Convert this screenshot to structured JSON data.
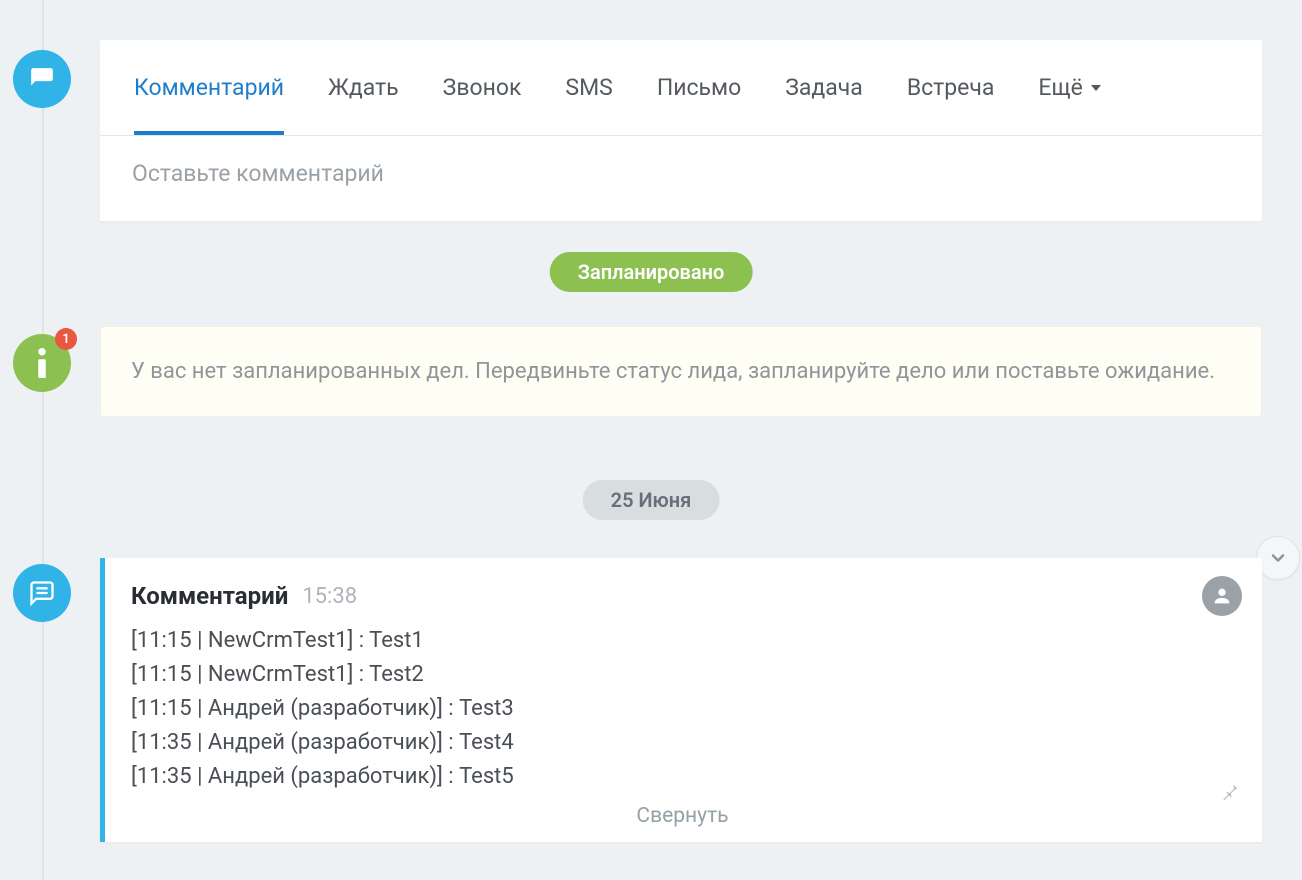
{
  "tabs": {
    "items": [
      {
        "label": "Комментарий",
        "name": "tab-comment",
        "active": true
      },
      {
        "label": "Ждать",
        "name": "tab-wait",
        "active": false
      },
      {
        "label": "Звонок",
        "name": "tab-call",
        "active": false
      },
      {
        "label": "SMS",
        "name": "tab-sms",
        "active": false
      },
      {
        "label": "Письмо",
        "name": "tab-email",
        "active": false
      },
      {
        "label": "Задача",
        "name": "tab-task",
        "active": false
      },
      {
        "label": "Встреча",
        "name": "tab-meeting",
        "active": false
      }
    ],
    "more_label": "Ещё"
  },
  "comment_input": {
    "placeholder": "Оставьте комментарий"
  },
  "planned_pill": "Запланировано",
  "info_badge_count": "1",
  "info_message": "У вас нет запланированных дел. Передвиньте статус лида, запланируйте дело или поставьте ожидание.",
  "date_pill": "25 Июня",
  "entry": {
    "title": "Комментарий",
    "time": "15:38",
    "lines": [
      "[11:15 | NewCrmTest1] : Test1",
      "[11:15 | NewCrmTest1] : Test2",
      "[11:15 | Андрей (разработчик)] : Test3",
      "[11:35 | Андрей (разработчик)] : Test4",
      "[11:35 | Андрей (разработчик)] : Test5"
    ],
    "collapse_label": "Свернуть"
  }
}
